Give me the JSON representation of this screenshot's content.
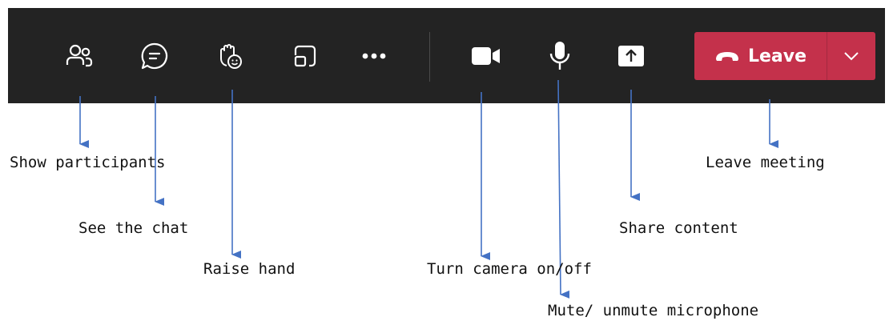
{
  "toolbar": {
    "buttons": [
      {
        "icon": "people-icon"
      },
      {
        "icon": "chat-icon"
      },
      {
        "icon": "raise-hand-icon"
      },
      {
        "icon": "pop-out-icon"
      },
      {
        "icon": "more-options-icon"
      },
      {
        "icon": "camera-icon"
      },
      {
        "icon": "microphone-icon"
      },
      {
        "icon": "share-screen-icon"
      }
    ],
    "leave": {
      "label": "Leave",
      "icon": "hang-up-icon",
      "dropdown_icon": "chevron-down-icon",
      "color": "#c4314b"
    },
    "background": "#232323"
  },
  "annotations": {
    "participants": "Show participants",
    "chat": "See the chat",
    "raise_hand": "Raise hand",
    "camera": "Turn camera on/off",
    "microphone": "Mute/ unmute microphone",
    "share": "Share content",
    "leave": "Leave meeting"
  },
  "arrow_color": "#4472c4"
}
